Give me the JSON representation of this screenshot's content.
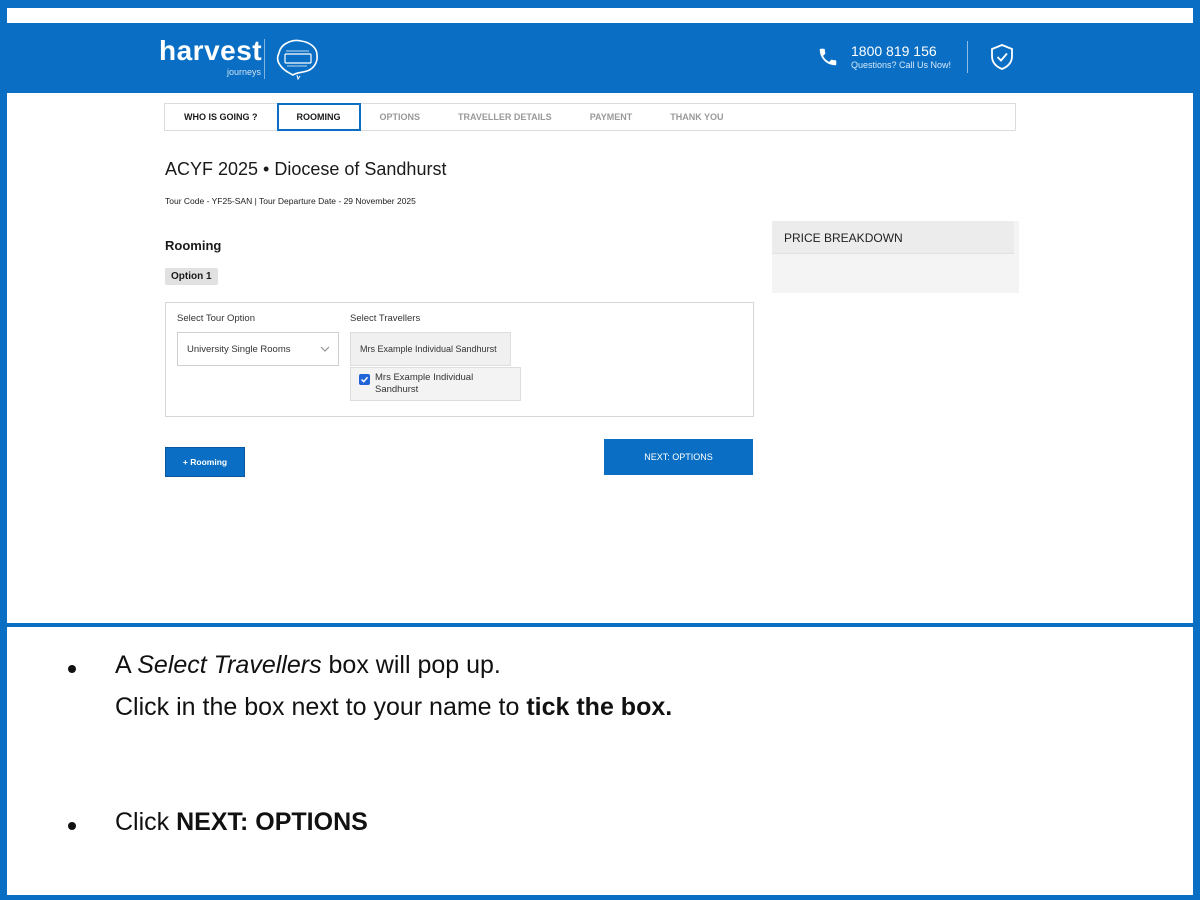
{
  "header": {
    "logo_word": "harvest",
    "logo_sub": "journeys",
    "phone_number": "1800 819 156",
    "phone_sub": "Questions? Call Us Now!",
    "brand_color": "#0a6fc4"
  },
  "steps": [
    {
      "label": "WHO IS GOING ?"
    },
    {
      "label": "ROOMING"
    },
    {
      "label": "OPTIONS"
    },
    {
      "label": "TRAVELLER DETAILS"
    },
    {
      "label": "PAYMENT"
    },
    {
      "label": "THANK YOU"
    }
  ],
  "tour": {
    "title": "ACYF 2025 • Diocese of Sandhurst",
    "meta": "Tour Code - YF25-SAN | Tour Departure Date - 29 November 2025"
  },
  "rooming": {
    "section_title": "Rooming",
    "option_badge": "Option 1",
    "tour_option_label": "Select Tour Option",
    "tour_option_value": "University Single Rooms",
    "travellers_label": "Select Travellers",
    "travellers_value": "Mrs Example Individual Sandhurst",
    "traveller_option": "Mrs Example Individual Sandhurst",
    "traveller_checked": true
  },
  "buttons": {
    "back_label": "+ Rooming",
    "next_label": "NEXT: OPTIONS"
  },
  "price": {
    "title": "PRICE BREAKDOWN"
  },
  "instructions": {
    "line1_a": "A ",
    "line1_em": "Select Travellers",
    "line1_b": " box will pop up.",
    "line2_a": "Click in the box next to your name to ",
    "line2_strong": "tick the box.",
    "line3_a": "Click ",
    "line3_strong": "NEXT: OPTIONS"
  }
}
